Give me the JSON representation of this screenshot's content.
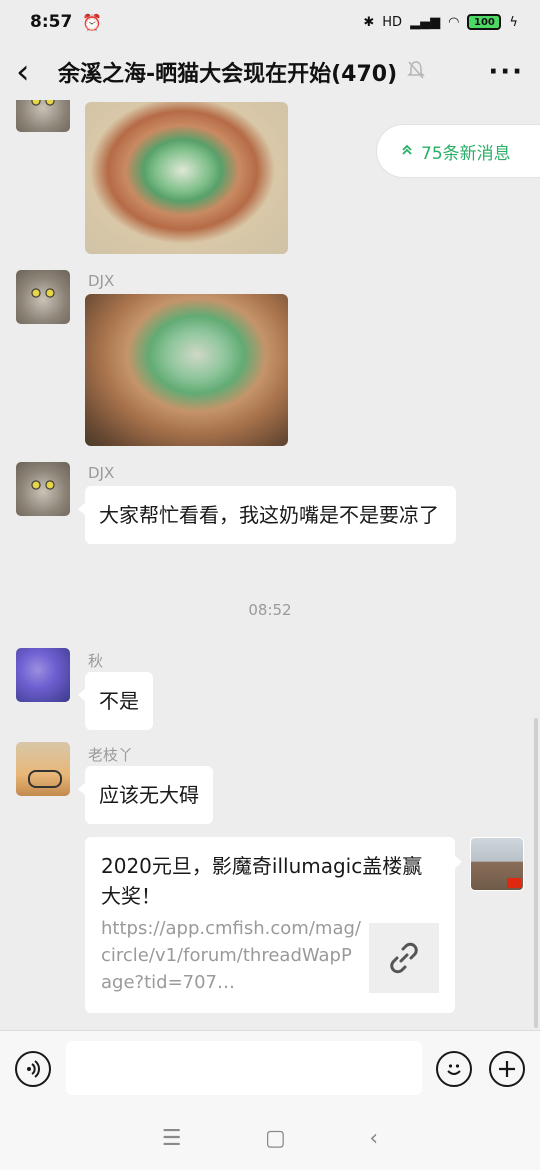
{
  "status_bar": {
    "time": "8:57",
    "network": "HD",
    "battery": "100"
  },
  "header": {
    "title": "余溪之海-晒猫大会现在开始(470)"
  },
  "new_messages": {
    "label": "75条新消息"
  },
  "messages": [
    {
      "sender": "DJX"
    },
    {
      "sender": "DJX",
      "text": "大家帮忙看看，我这奶嘴是不是要凉了"
    },
    {
      "timestamp": "08:52"
    },
    {
      "sender": "秋",
      "text": "不是"
    },
    {
      "sender": "老枝丫",
      "text": "应该无大碍"
    },
    {
      "link_title": "2020元旦，影魔奇illumagic盖楼赢大奖！",
      "link_url": "https://app.cmfish.com/mag/circle/v1/forum/threadWapPage?tid=707…"
    }
  ],
  "colors": {
    "accent": "#2aae67",
    "background": "#ededed"
  }
}
